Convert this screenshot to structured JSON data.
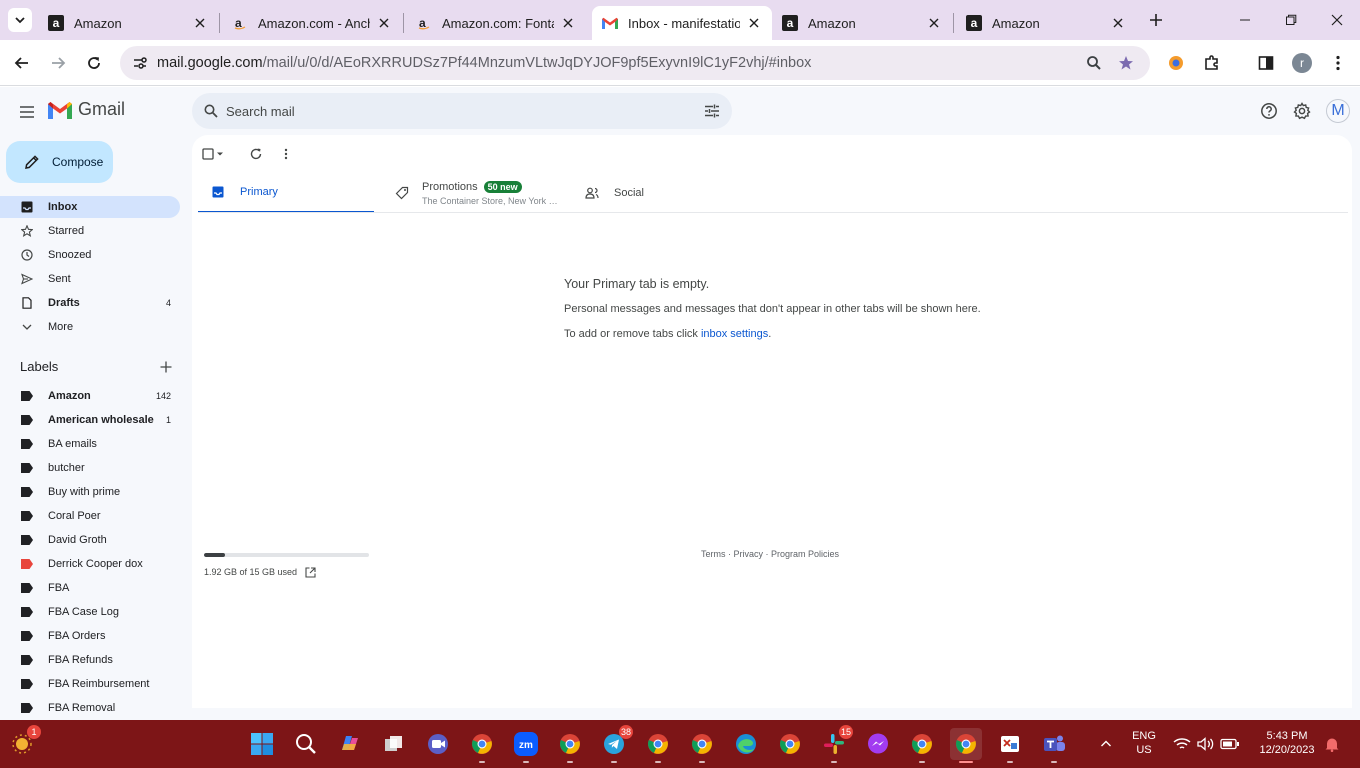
{
  "browser": {
    "tabs": [
      {
        "title": "Amazon",
        "favicon": "amazon-icon",
        "active": false
      },
      {
        "title": "Amazon.com - Anchor",
        "favicon": "amazon-icon",
        "active": false
      },
      {
        "title": "Amazon.com: Fontana",
        "favicon": "amazon-icon",
        "active": false
      },
      {
        "title": "Inbox - manifestation",
        "favicon": "gmail-icon",
        "active": true
      },
      {
        "title": "Amazon",
        "favicon": "amazon-icon",
        "active": false
      },
      {
        "title": "Amazon",
        "favicon": "amazon-icon",
        "active": false
      }
    ],
    "address": {
      "host": "mail.google.com",
      "path": "/mail/u/0/d/AEoRXRRUDSz7Pf44MnzumVLtwJqDYJOF9pf5ExyvnI9lC1yF2vhj/#inbox"
    },
    "profile_initial": "r"
  },
  "gmail": {
    "app_name": "Gmail",
    "search_placeholder": "Search mail",
    "avatar_initial": "M",
    "compose_label": "Compose",
    "nav": [
      {
        "label": "Inbox",
        "count": "",
        "icon": "inbox-icon",
        "active": true,
        "bold": true
      },
      {
        "label": "Starred",
        "count": "",
        "icon": "star-icon",
        "active": false,
        "bold": false
      },
      {
        "label": "Snoozed",
        "count": "",
        "icon": "clock-icon",
        "active": false,
        "bold": false
      },
      {
        "label": "Sent",
        "count": "",
        "icon": "send-icon",
        "active": false,
        "bold": false
      },
      {
        "label": "Drafts",
        "count": "4",
        "icon": "draft-icon",
        "active": false,
        "bold": true
      },
      {
        "label": "More",
        "count": "",
        "icon": "chevron-down-icon",
        "active": false,
        "bold": false
      }
    ],
    "labels_header": "Labels",
    "labels": [
      {
        "name": "Amazon",
        "count": "142",
        "bold": true,
        "color": "#202124"
      },
      {
        "name": "American wholesale",
        "count": "1",
        "bold": true,
        "color": "#202124"
      },
      {
        "name": "BA emails",
        "count": "",
        "bold": false,
        "color": "#202124"
      },
      {
        "name": "butcher",
        "count": "",
        "bold": false,
        "color": "#202124"
      },
      {
        "name": "Buy with prime",
        "count": "",
        "bold": false,
        "color": "#202124"
      },
      {
        "name": "Coral Poer",
        "count": "",
        "bold": false,
        "color": "#202124"
      },
      {
        "name": "David Groth",
        "count": "",
        "bold": false,
        "color": "#202124"
      },
      {
        "name": "Derrick Cooper dox",
        "count": "",
        "bold": false,
        "color": "#e8453c"
      },
      {
        "name": "FBA",
        "count": "",
        "bold": false,
        "color": "#202124"
      },
      {
        "name": "FBA Case Log",
        "count": "",
        "bold": false,
        "color": "#202124"
      },
      {
        "name": "FBA Orders",
        "count": "",
        "bold": false,
        "color": "#202124"
      },
      {
        "name": "FBA Refunds",
        "count": "",
        "bold": false,
        "color": "#202124"
      },
      {
        "name": "FBA Reimbursement",
        "count": "",
        "bold": false,
        "color": "#202124"
      },
      {
        "name": "FBA Removal",
        "count": "",
        "bold": false,
        "color": "#202124"
      }
    ],
    "tabs": {
      "primary": "Primary",
      "promotions": "Promotions",
      "promotions_badge": "50 new",
      "promotions_preview": "The Container Store, New York C...",
      "social": "Social"
    },
    "empty": {
      "title": "Your Primary tab is empty.",
      "line1": "Personal messages and messages that don't appear in other tabs will be shown here.",
      "line2_prefix": "To add or remove tabs click ",
      "line2_link": "inbox settings",
      "line2_suffix": "."
    },
    "storage": {
      "text": "1.92 GB of 15 GB used",
      "fraction": 0.128
    },
    "footer": "Terms · Privacy · Program Policies"
  },
  "taskbar": {
    "apps": [
      {
        "name": "widgets",
        "badge": "1"
      },
      {
        "name": "start",
        "badge": ""
      },
      {
        "name": "search",
        "badge": ""
      },
      {
        "name": "copilot",
        "badge": ""
      },
      {
        "name": "task-view",
        "badge": ""
      },
      {
        "name": "meet",
        "badge": ""
      },
      {
        "name": "chrome",
        "badge": ""
      },
      {
        "name": "zoom",
        "badge": ""
      },
      {
        "name": "chrome",
        "badge": ""
      },
      {
        "name": "telegram",
        "badge": "38"
      },
      {
        "name": "chrome",
        "badge": ""
      },
      {
        "name": "chrome",
        "badge": ""
      },
      {
        "name": "edge",
        "badge": ""
      },
      {
        "name": "chrome",
        "badge": ""
      },
      {
        "name": "slack",
        "badge": "15"
      },
      {
        "name": "messenger",
        "badge": ""
      },
      {
        "name": "chrome",
        "badge": ""
      },
      {
        "name": "chrome",
        "badge": ""
      },
      {
        "name": "snipping",
        "badge": ""
      },
      {
        "name": "teams",
        "badge": ""
      }
    ],
    "lang": "ENG",
    "region": "US",
    "time": "5:43 PM",
    "date": "12/20/2023"
  }
}
